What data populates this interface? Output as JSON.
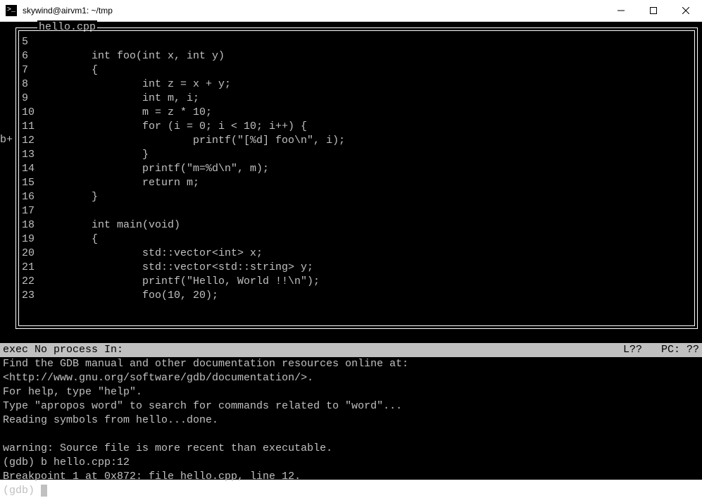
{
  "window": {
    "title": "skywind@airvm1: ~/tmp"
  },
  "source": {
    "filename": "hello.cpp",
    "breakpoint_marker": "b+",
    "breakpoint_line": 12,
    "lines": [
      {
        "n": "5",
        "code": ""
      },
      {
        "n": "6",
        "code": "       int foo(int x, int y)"
      },
      {
        "n": "7",
        "code": "       {"
      },
      {
        "n": "8",
        "code": "               int z = x + y;"
      },
      {
        "n": "9",
        "code": "               int m, i;"
      },
      {
        "n": "10",
        "code": "               m = z * 10;"
      },
      {
        "n": "11",
        "code": "               for (i = 0; i < 10; i++) {"
      },
      {
        "n": "12",
        "code": "                       printf(\"[%d] foo\\n\", i);"
      },
      {
        "n": "13",
        "code": "               }"
      },
      {
        "n": "14",
        "code": "               printf(\"m=%d\\n\", m);"
      },
      {
        "n": "15",
        "code": "               return m;"
      },
      {
        "n": "16",
        "code": "       }"
      },
      {
        "n": "17",
        "code": ""
      },
      {
        "n": "18",
        "code": "       int main(void)"
      },
      {
        "n": "19",
        "code": "       {"
      },
      {
        "n": "20",
        "code": "               std::vector<int> x;"
      },
      {
        "n": "21",
        "code": "               std::vector<std::string> y;"
      },
      {
        "n": "22",
        "code": "               printf(\"Hello, World !!\\n\");"
      },
      {
        "n": "23",
        "code": "               foo(10, 20);"
      }
    ]
  },
  "status": {
    "left": "exec No process In:",
    "right": "L??   PC: ??"
  },
  "console": {
    "lines": [
      "Find the GDB manual and other documentation resources online at:",
      "<http://www.gnu.org/software/gdb/documentation/>.",
      "For help, type \"help\".",
      "Type \"apropos word\" to search for commands related to \"word\"...",
      "Reading symbols from hello...done.",
      "",
      "warning: Source file is more recent than executable.",
      "(gdb) b hello.cpp:12",
      "Breakpoint 1 at 0x872: file hello.cpp, line 12.",
      "(gdb) "
    ]
  }
}
